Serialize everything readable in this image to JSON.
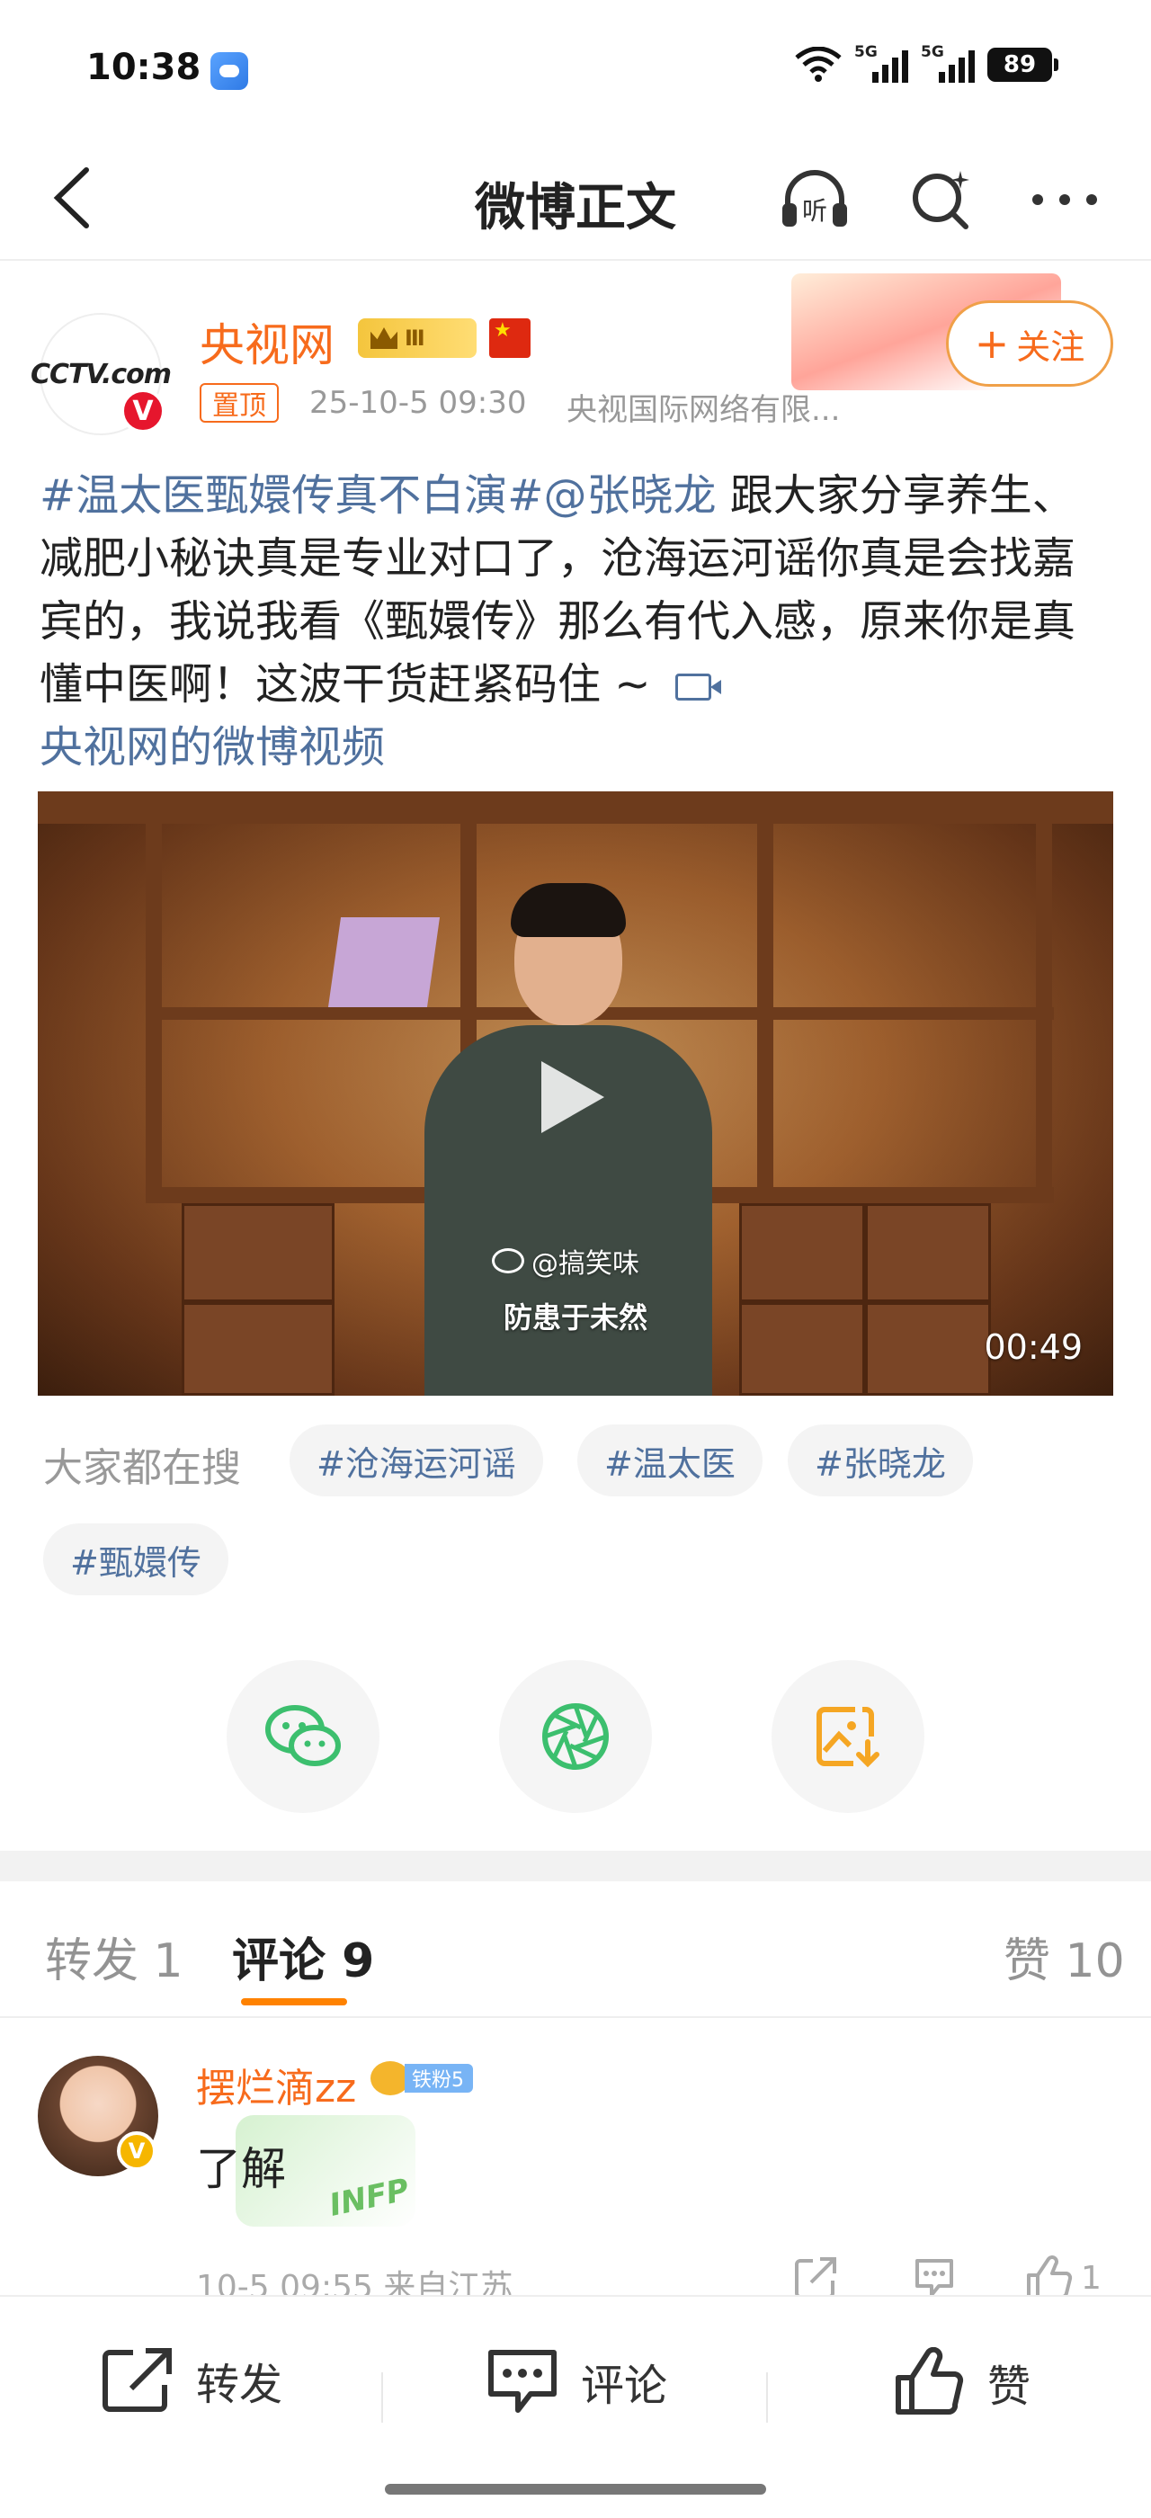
{
  "status_bar": {
    "time": "10:38",
    "network_1": "5G",
    "network_2": "5G",
    "battery": "89"
  },
  "nav": {
    "title": "微博正文",
    "listen_label": "听"
  },
  "author": {
    "name": "央视网",
    "level": "Ⅲ",
    "pinned": "置顶",
    "time": "25-10-5 09:30",
    "source": "央视国际网络有限...",
    "follow_label": "关注",
    "avatar_text": "CCTV.com"
  },
  "post": {
    "topic_1": "#温太医甄嬛传真不白演#",
    "mention": "@张晓龙",
    "body": " 跟大家分享养生、减肥小秘诀真是专业对口了，沧海运河谣你真是会找嘉宾的，我说我看《甄嬛传》那么有代入感，原来你是真懂中医啊！这波干货赶紧码住 ~ ",
    "video_link": "央视网的微博视频"
  },
  "video": {
    "watermark": "@搞笑味",
    "subtitle": "防患于未然",
    "duration": "00:49"
  },
  "search": {
    "label": "大家都在搜",
    "tags": [
      "#沧海运河谣",
      "#温太医",
      "#张晓龙",
      "#甄嬛传"
    ]
  },
  "share": {
    "items": [
      "wechat-icon",
      "moments-icon",
      "save-image-icon"
    ]
  },
  "tabs": {
    "repost": "转发 1",
    "comment": "评论 9",
    "like": "赞 10"
  },
  "comment": {
    "user": "摆烂滴zz",
    "fan_badge": "铁粉5",
    "text": "了解",
    "sticker": "INFP",
    "meta": "10-5 09:55  来自江苏",
    "like_count": "1"
  },
  "bottom_bar": {
    "repost": "转发",
    "comment": "评论",
    "like": "赞"
  },
  "colors": {
    "accent": "#f76b1c",
    "topic": "#50719e",
    "tab_underline": "#ff8200"
  }
}
